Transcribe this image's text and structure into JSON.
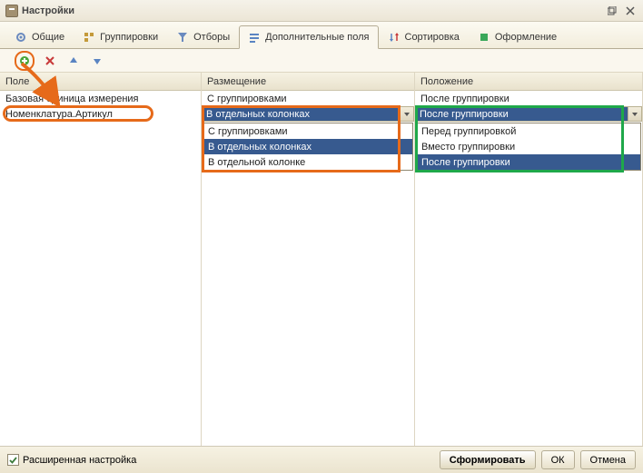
{
  "window": {
    "title": "Настройки"
  },
  "tabs": [
    {
      "id": "general",
      "label": "Общие"
    },
    {
      "id": "grouping",
      "label": "Группировки"
    },
    {
      "id": "filter",
      "label": "Отборы"
    },
    {
      "id": "extra",
      "label": "Дополнительные поля",
      "active": true
    },
    {
      "id": "sort",
      "label": "Сортировка"
    },
    {
      "id": "format",
      "label": "Оформление"
    }
  ],
  "toolbar": {
    "add_tip": "Добавить",
    "del_tip": "Удалить",
    "up_tip": "Вверх",
    "down_tip": "Вниз"
  },
  "columns": {
    "field": {
      "header": "Поле"
    },
    "placement": {
      "header": "Размещение"
    },
    "position": {
      "header": "Положение"
    }
  },
  "rows": [
    {
      "field": "Базовая единица измерения",
      "placement": "С группировками",
      "position": "После группировки"
    },
    {
      "field": "Номенклатура.Артикул",
      "placement": "В отдельных колонках",
      "position": "После группировки"
    }
  ],
  "placement_options": [
    "С группировками",
    "В отдельных колонках",
    "В отдельной колонке"
  ],
  "placement_selected_index": 1,
  "position_options": [
    "Перед группировкой",
    "Вместо группировки",
    "После группировки"
  ],
  "position_selected_index": 2,
  "footer": {
    "adv_label": "Расширенная настройка",
    "generate": "Сформировать",
    "ok": "ОК",
    "cancel": "Отмена"
  }
}
